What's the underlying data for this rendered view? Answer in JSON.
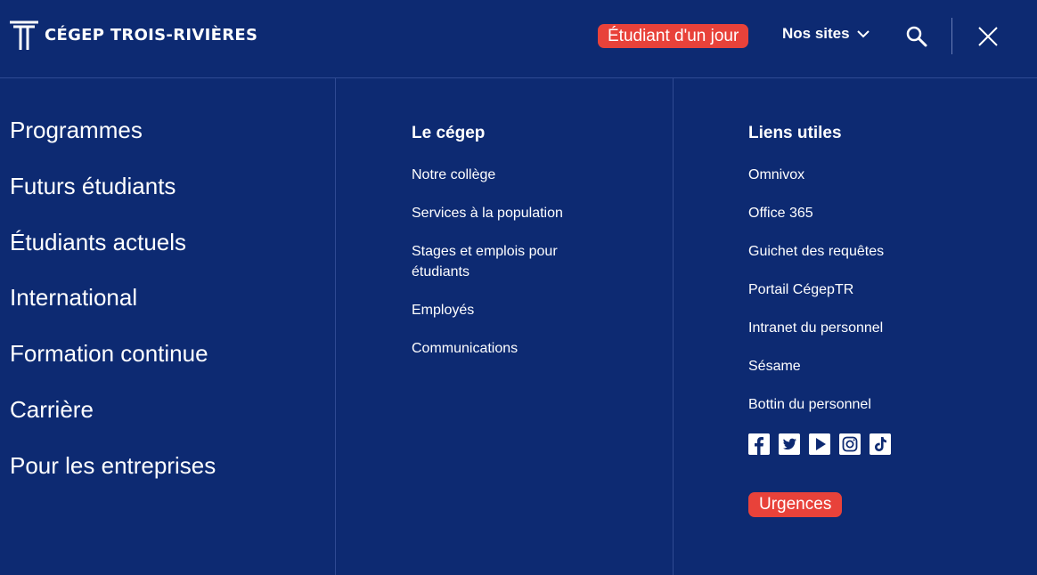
{
  "header": {
    "logo_text": "CÉGEP TROIS-RIVIÈRES",
    "etudiant_label": "Étudiant d'un jour",
    "nos_sites_label": "Nos sites"
  },
  "main_nav": [
    "Programmes",
    "Futurs étudiants",
    "Étudiants actuels",
    "International",
    "Formation continue",
    "Carrière",
    "Pour les entreprises"
  ],
  "le_cegep": {
    "title": "Le cégep",
    "links": [
      "Notre collège",
      "Services à la population",
      "Stages et emplois pour étudiants",
      "Employés",
      "Communications"
    ]
  },
  "liens_utiles": {
    "title": "Liens utiles",
    "links": [
      "Omnivox",
      "Office 365",
      "Guichet des requêtes",
      "Portail CégepTR",
      "Intranet du personnel",
      "Sésame",
      "Bottin du personnel"
    ]
  },
  "social_icons": [
    "facebook-icon",
    "twitter-icon",
    "youtube-icon",
    "instagram-icon",
    "tiktok-icon"
  ],
  "urgences_label": "Urgences",
  "colors": {
    "background": "#0d2a72",
    "accent": "#e8423a",
    "text": "#ffffff"
  }
}
